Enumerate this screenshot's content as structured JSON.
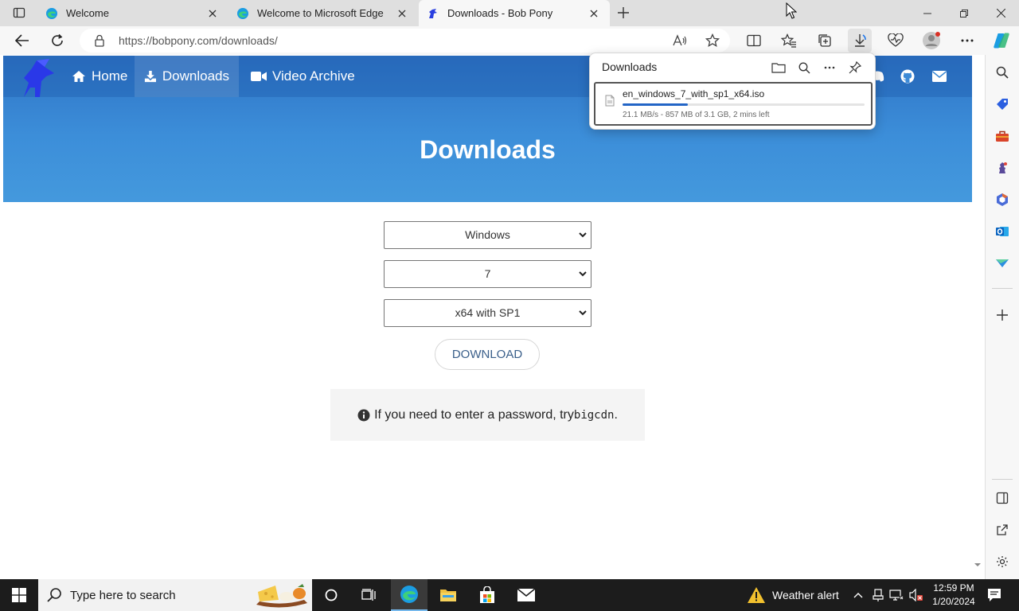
{
  "browser": {
    "tabs": [
      {
        "title": "Welcome",
        "favicon": "edge-icon",
        "active": false
      },
      {
        "title": "Welcome to Microsoft Edge",
        "favicon": "edge-icon",
        "active": false
      },
      {
        "title": "Downloads - Bob Pony",
        "favicon": "bobpony-icon",
        "active": true
      }
    ],
    "url": "https://bobpony.com/downloads/"
  },
  "site": {
    "nav": {
      "home": "Home",
      "downloads": "Downloads",
      "video_archive": "Video Archive"
    },
    "hero_title": "Downloads",
    "selects": {
      "os": "Windows",
      "version": "7",
      "edition": "x64 with SP1"
    },
    "download_button": "DOWNLOAD",
    "note": {
      "prefix": "If you need to enter a password, try ",
      "code": "bigcdn",
      "suffix": "."
    }
  },
  "downloads_panel": {
    "title": "Downloads",
    "item": {
      "filename": "en_windows_7_with_sp1_x64.iso",
      "status": "21.1 MB/s - 857 MB of 3.1 GB, 2 mins left",
      "progress": 0.27
    }
  },
  "taskbar": {
    "search_placeholder": "Type here to search",
    "weather": "Weather alert",
    "time": "12:59 PM",
    "date": "1/20/2024"
  },
  "colors": {
    "hero_start": "#2f74c6",
    "hero_end": "#4499dd",
    "progress": "#2365c6",
    "edge_accent": "#1b9de2"
  }
}
